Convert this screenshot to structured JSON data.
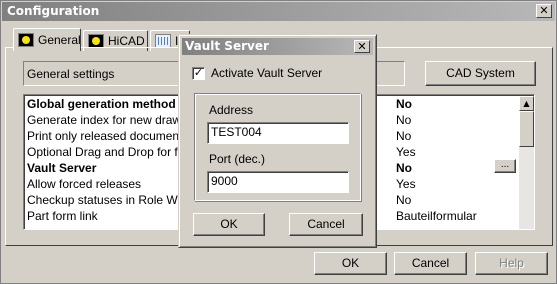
{
  "window": {
    "title": "Configuration",
    "close_glyph": "✕"
  },
  "tabs": [
    {
      "label": "General",
      "icon": "hicad-icon"
    },
    {
      "label": "HiCAD",
      "icon": "hicad-icon"
    },
    {
      "label": "I",
      "icon": "grid-icon"
    }
  ],
  "general": {
    "section_label": "General settings",
    "cad_system_label": "CAD System",
    "settings": [
      {
        "name": "Global generation method for file",
        "value": "No",
        "bold": true
      },
      {
        "name": "Generate index for new drawing",
        "value": "No",
        "bold": false
      },
      {
        "name": "Print only released documents",
        "value": "No",
        "bold": false
      },
      {
        "name": "Optional Drag and Drop for follow",
        "value": "Yes",
        "bold": false
      },
      {
        "name": "Vault Server",
        "value": "No",
        "bold": true,
        "has_button": true
      },
      {
        "name": "Allow forced releases",
        "value": "Yes",
        "bold": false
      },
      {
        "name": "Checkup statuses in Role Work",
        "value": "No",
        "bold": false
      },
      {
        "name": "Part form link",
        "value": "Bauteilformular",
        "bold": false
      }
    ],
    "ellipsis_label": "..."
  },
  "footer": {
    "ok_label": "OK",
    "cancel_label": "Cancel",
    "help_label": "Help"
  },
  "vault_dialog": {
    "title": "Vault Server",
    "close_glyph": "✕",
    "activate_label": "Activate Vault Server",
    "activate_checked": true,
    "check_glyph": "✓",
    "address_label": "Address",
    "address_value": "TEST004",
    "port_label": "Port (dec.)",
    "port_value": "9000",
    "ok_label": "OK",
    "cancel_label": "Cancel"
  },
  "scrollbar": {
    "up_glyph": "▲",
    "down_glyph": "▼"
  }
}
